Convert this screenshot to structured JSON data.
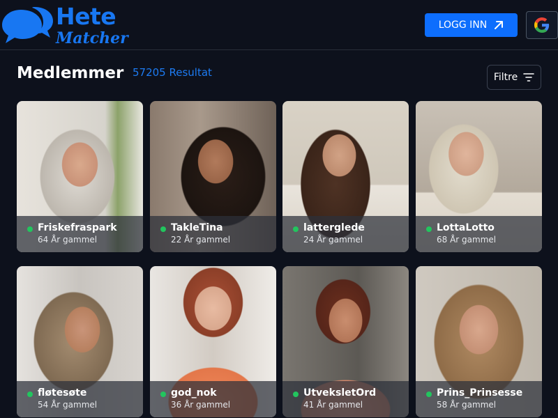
{
  "brand": {
    "line1": "Hete",
    "line2": "Matcher",
    "color": "#1877f2"
  },
  "header": {
    "login_label": "LOGG INN",
    "login_icon": "arrow-up-right-icon",
    "google_icon": "google-icon"
  },
  "page": {
    "title": "Medlemmer",
    "result_count": "57205 Resultat",
    "filter_label": "Filtre",
    "filter_icon": "filter-lines-icon"
  },
  "online_color": "#22c55e",
  "members": [
    {
      "name": "Friskefraspark",
      "age": "64 År gammel",
      "online": true
    },
    {
      "name": "TakleTina",
      "age": "22 År gammel",
      "online": true
    },
    {
      "name": "latterglede",
      "age": "24 År gammel",
      "online": true
    },
    {
      "name": "LottaLotto",
      "age": "68 År gammel",
      "online": true
    },
    {
      "name": "fløtesøte",
      "age": "54 År gammel",
      "online": true
    },
    {
      "name": "god_nok",
      "age": "36 År gammel",
      "online": true
    },
    {
      "name": "UtveksletOrd",
      "age": "41 År gammel",
      "online": true
    },
    {
      "name": "Prins_Prinsesse",
      "age": "58 År gammel",
      "online": true
    }
  ]
}
